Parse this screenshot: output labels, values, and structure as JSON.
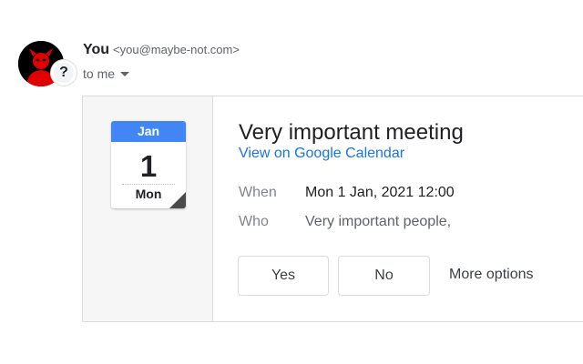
{
  "sender": {
    "name": "You",
    "email": "<you@maybe-not.com>",
    "recipient_label": "to me",
    "avatar_badge": "?"
  },
  "icons": {
    "avatar": "devil-avatar-icon",
    "badge": "question-mark-icon",
    "expand": "chevron-down-icon",
    "calendar": "calendar-date-icon"
  },
  "colors": {
    "link": "#1a73e8",
    "calendar_header": "#4285f4",
    "avatar_red": "#e00000"
  },
  "event": {
    "calendar_icon": {
      "month": "Jan",
      "day": "1",
      "weekday": "Mon"
    },
    "title": "Very important meeting",
    "calendar_link": "View on Google Calendar",
    "when_label": "When",
    "when_value": "Mon 1 Jan, 2021 12:00",
    "who_label": "Who",
    "who_value": "Very important people,"
  },
  "actions": {
    "yes": "Yes",
    "no": "No",
    "more": "More options"
  }
}
